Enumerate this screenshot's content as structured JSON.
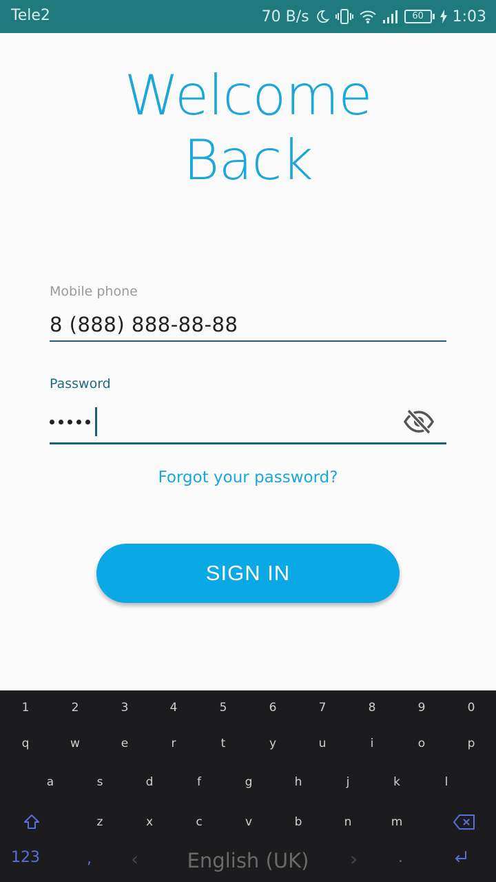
{
  "status_bar": {
    "carrier": "Tele2",
    "net_speed": "70 B/s",
    "battery": "60",
    "time": "1:03"
  },
  "title": {
    "line1": "Welcome",
    "line2": "Back"
  },
  "form": {
    "phone_label": "Mobile phone",
    "phone_value": "8 (888) 888-88-88",
    "password_label": "Password",
    "password_masked": "•••••"
  },
  "forgot_link": "Forgot your password?",
  "sign_in_label": "SIGN IN",
  "keyboard": {
    "number_row": [
      "1",
      "2",
      "3",
      "4",
      "5",
      "6",
      "7",
      "8",
      "9",
      "0"
    ],
    "row_q": [
      "q",
      "w",
      "e",
      "r",
      "t",
      "y",
      "u",
      "i",
      "o",
      "p"
    ],
    "row_a": [
      "a",
      "s",
      "d",
      "f",
      "g",
      "h",
      "j",
      "k",
      "l"
    ],
    "row_z": [
      "z",
      "x",
      "c",
      "v",
      "b",
      "n",
      "m"
    ],
    "switch_label": "123",
    "comma": ",",
    "space_label": "English (UK)",
    "period": "."
  },
  "colors": {
    "status_bar": "#1e7a7c",
    "accent": "#1ba7d8",
    "button": "#0aa9e6",
    "underline": "#1d5f78",
    "keyboard_bg": "#1c1c1e"
  }
}
